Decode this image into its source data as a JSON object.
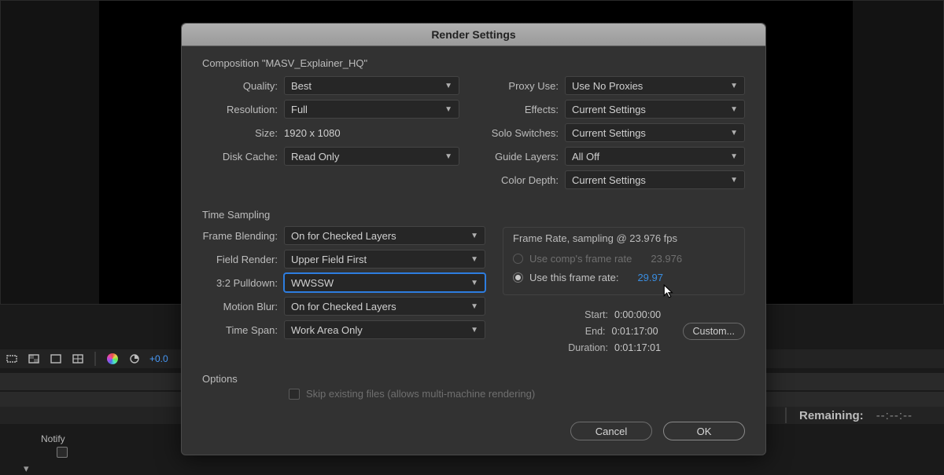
{
  "dialog": {
    "title": "Render Settings",
    "composition": "Composition \"MASV_Explainer_HQ\"",
    "left": {
      "quality_label": "Quality:",
      "quality_value": "Best",
      "resolution_label": "Resolution:",
      "resolution_value": "Full",
      "size_label": "Size:",
      "size_value": "1920 x 1080",
      "diskcache_label": "Disk Cache:",
      "diskcache_value": "Read Only"
    },
    "right": {
      "proxy_label": "Proxy Use:",
      "proxy_value": "Use No Proxies",
      "effects_label": "Effects:",
      "effects_value": "Current Settings",
      "solo_label": "Solo Switches:",
      "solo_value": "Current Settings",
      "guide_label": "Guide Layers:",
      "guide_value": "All Off",
      "depth_label": "Color Depth:",
      "depth_value": "Current Settings"
    },
    "time_sampling_label": "Time Sampling",
    "time": {
      "blend_label": "Frame Blending:",
      "blend_value": "On for Checked Layers",
      "field_label": "Field Render:",
      "field_value": "Upper Field First",
      "pulldown_label": "3:2 Pulldown:",
      "pulldown_value": "WWSSW",
      "motion_label": "Motion Blur:",
      "motion_value": "On for Checked Layers",
      "span_label": "Time Span:",
      "span_value": "Work Area Only"
    },
    "framerate": {
      "title": "Frame Rate, sampling @ 23.976 fps",
      "opt1": "Use comp's frame rate",
      "opt1_val": "23.976",
      "opt2": "Use this frame rate:",
      "opt2_val": "29.97"
    },
    "tinfo": {
      "start_label": "Start:",
      "start_val": "0:00:00:00",
      "end_label": "End:",
      "end_val": "0:01:17:00",
      "dur_label": "Duration:",
      "dur_val": "0:01:17:01",
      "custom": "Custom..."
    },
    "options_label": "Options",
    "skip_label": "Skip existing files (allows multi-machine rendering)",
    "cancel": "Cancel",
    "ok": "OK"
  },
  "bottom": {
    "exposure": "+0.0",
    "notify": "Notify",
    "remaining_label": "Remaining:",
    "remaining_time": "--:--:--"
  }
}
